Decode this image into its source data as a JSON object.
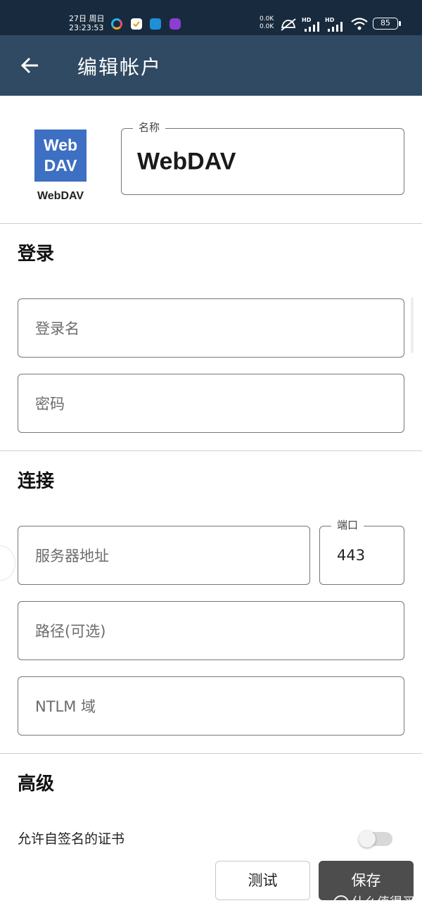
{
  "status_bar": {
    "date": "27日 周日",
    "time": "23:23:53",
    "net_up": "0.0K",
    "net_down": "0.0K",
    "hd1": "HD",
    "hd2": "HD",
    "battery": "85"
  },
  "app_bar": {
    "title": "编辑帐户",
    "back_icon": "arrow-left-icon"
  },
  "account": {
    "logo_text_line1": "Web",
    "logo_text_line2": "DAV",
    "logo_caption": "WebDAV",
    "name_legend": "名称",
    "name_value": "WebDAV"
  },
  "login": {
    "title": "登录",
    "username_placeholder": "登录名",
    "password_placeholder": "密码"
  },
  "connection": {
    "title": "连接",
    "server_placeholder": "服务器地址",
    "port_legend": "端口",
    "port_value": "443",
    "path_placeholder": "路径(可选)",
    "ntlm_placeholder": "NTLM 域"
  },
  "advanced": {
    "title": "高级",
    "self_signed_label": "允许自签名的证书",
    "self_signed_enabled": false
  },
  "buttons": {
    "test": "测试",
    "save": "保存"
  },
  "watermark": "什么值得买",
  "colors": {
    "status_bar": "#182a3e",
    "app_bar": "#2f4a62",
    "logo_bg": "#3d6fc2",
    "save_button": "#4d4d4d"
  }
}
